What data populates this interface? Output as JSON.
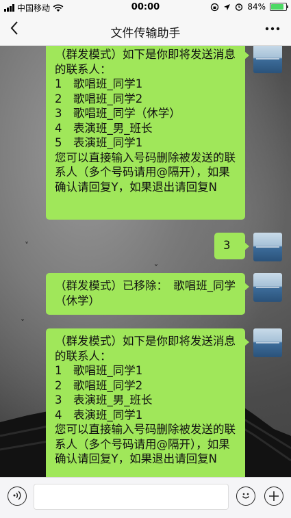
{
  "status": {
    "carrier": "中国移动",
    "time": "00:00",
    "battery_text": "84%"
  },
  "nav": {
    "back_icon": "chevron-left-icon",
    "title": "文件传输助手",
    "more_icon": "ellipsis-icon"
  },
  "messages": [
    {
      "text": "（群发模式）如下是你即将发送消息的联系人：\n1　歌唱班_同学1\n2　歌唱班_同学2\n3　歌唱班_同学（休学）\n4　表演班_男_班长\n5　表演班_同学1\n您可以直接输入号码删除被发送的联系人（多个号码请用@隔开），如果确认请回复Y，如果退出请回复N"
    },
    {
      "text": "3"
    },
    {
      "text": "（群发模式）已移除：　歌唱班_同学（休学）"
    },
    {
      "text": "（群发模式）如下是你即将发送消息的联系人：\n1　歌唱班_同学1\n2　歌唱班_同学2\n3　表演班_男_班长\n4　表演班_同学1\n您可以直接输入号码删除被发送的联系人（多个号码请用@隔开），如果确认请回复Y，如果退出请回复N"
    }
  ],
  "input": {
    "voice_icon": "voice-icon",
    "emoji_icon": "emoji-icon",
    "plus_icon": "plus-icon"
  },
  "colors": {
    "bubble": "#a0e75a",
    "bar": "#f7f7f7"
  }
}
